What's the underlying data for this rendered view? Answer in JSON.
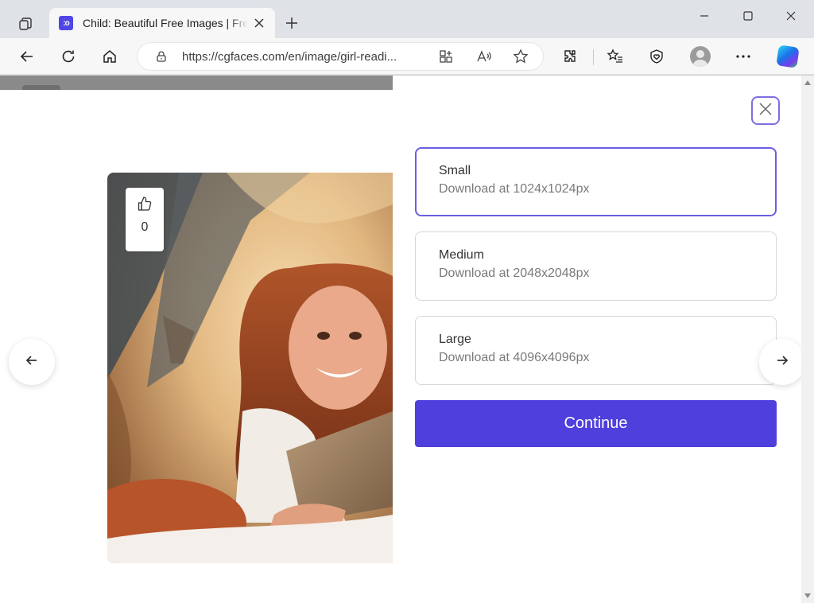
{
  "browser": {
    "tab": {
      "favicon_text": ":o",
      "title": "Child: Beautiful Free Images | Free AI Images"
    },
    "address": {
      "url": "https://cgfaces.com/en/image/girl-readi..."
    },
    "icons": {
      "tab_actions": "tab-actions-icon",
      "close_tab": "close-icon",
      "new_tab": "plus-icon",
      "minimize": "minimize-icon",
      "maximize": "maximize-icon",
      "close_window": "close-icon",
      "back": "back-arrow-icon",
      "refresh": "refresh-icon",
      "home": "home-icon",
      "site_info": "lock-icon",
      "apps": "grid-plus-icon",
      "read_aloud": "read-aloud-icon",
      "favorite": "star-icon",
      "extensions": "puzzle-icon",
      "favorites": "favorites-list-icon",
      "browser_essentials": "shield-heart-icon",
      "profile": "avatar-icon",
      "more": "more-icon",
      "copilot": "copilot-icon"
    }
  },
  "viewer": {
    "likes": "0",
    "prev_icon": "arrow-left-icon",
    "next_icon": "arrow-right-icon",
    "like_icon": "thumbs-up-icon"
  },
  "download_panel": {
    "close_icon": "close-icon",
    "options": [
      {
        "title": "Small",
        "subtitle": "Download at 1024x1024px",
        "selected": true
      },
      {
        "title": "Medium",
        "subtitle": "Download at 2048x2048px",
        "selected": false
      },
      {
        "title": "Large",
        "subtitle": "Download at 4096x4096px",
        "selected": false
      }
    ],
    "continue_label": "Continue"
  },
  "colors": {
    "accent": "#4f3fdc",
    "selected_border": "#6a5fe0",
    "tab_strip": "#dfe3e8",
    "toolbar": "#f7f7f7"
  }
}
